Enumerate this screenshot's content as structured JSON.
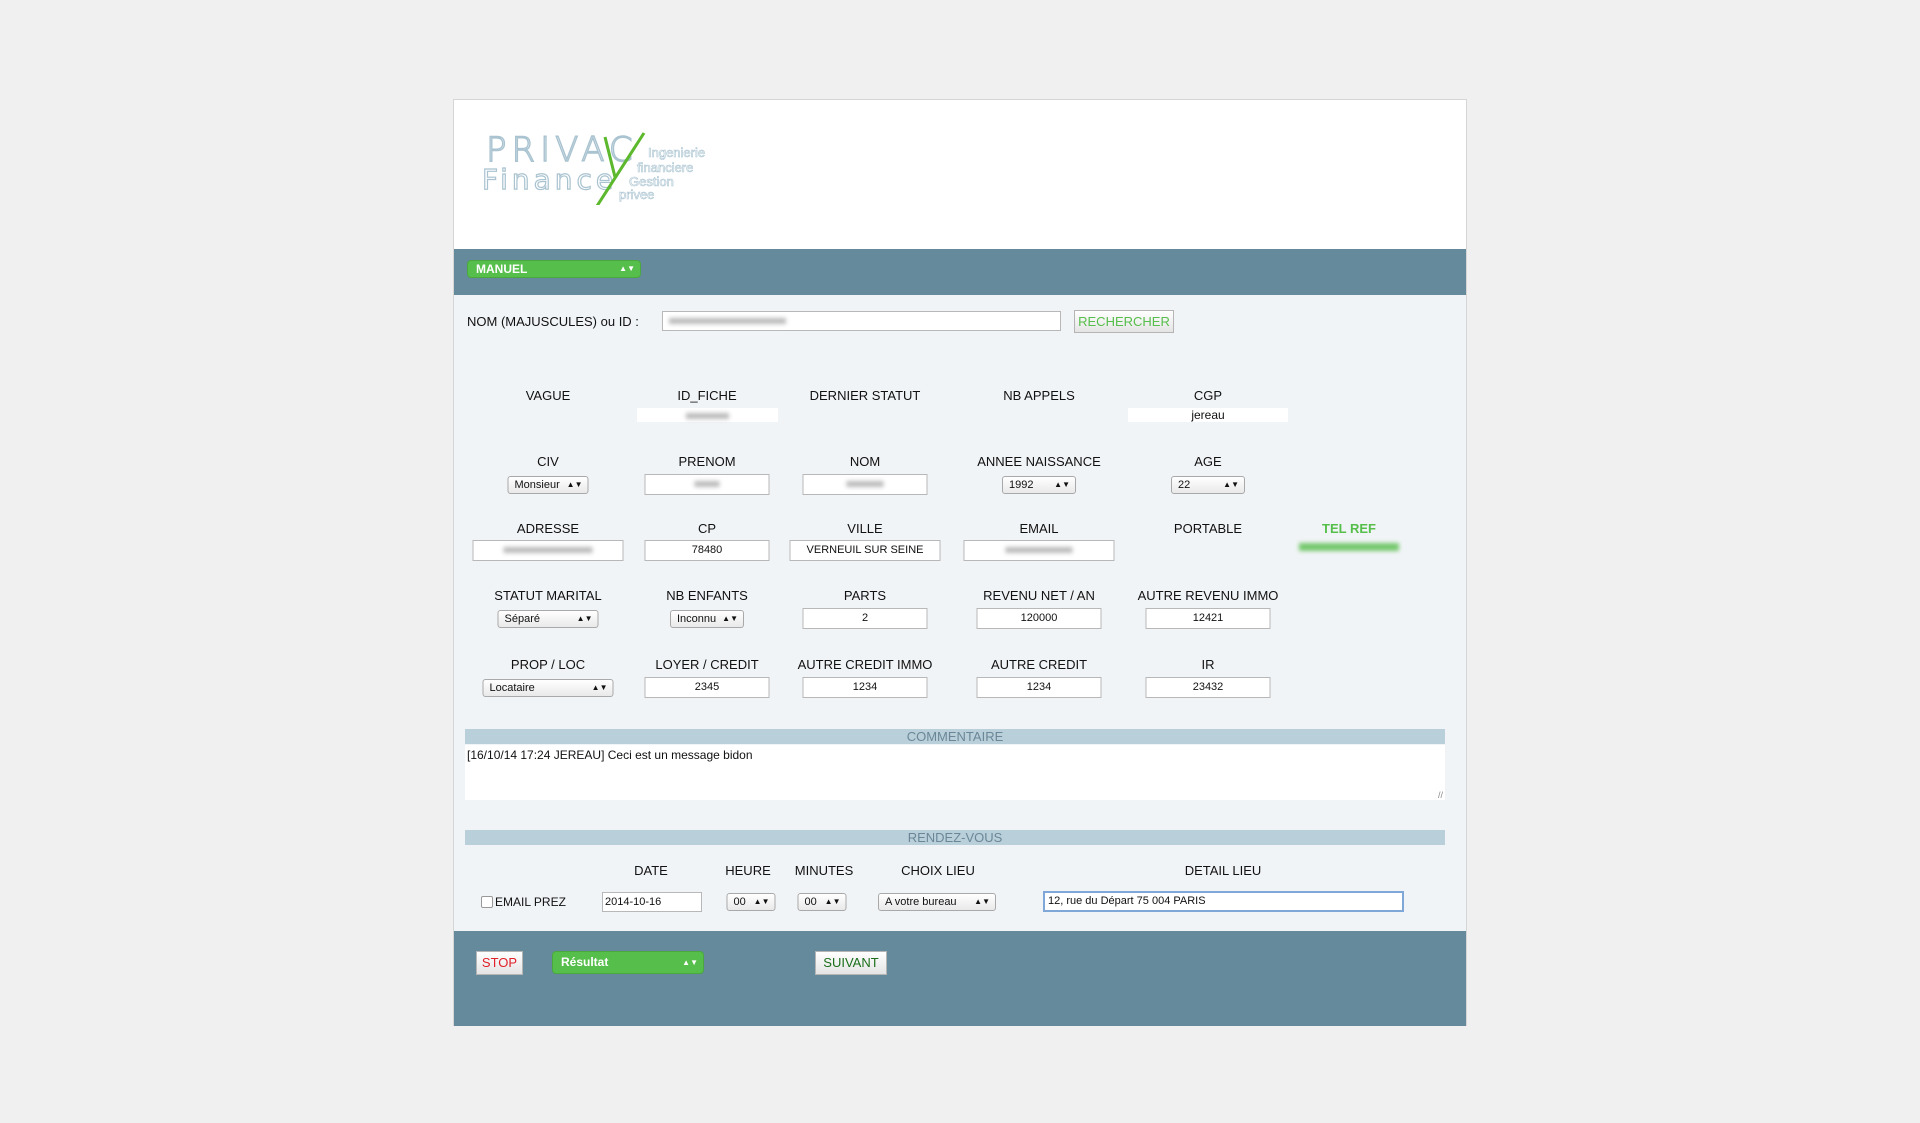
{
  "logo": {
    "brand_line1": "PRIVACY",
    "brand_line2": "Finance",
    "tagline": [
      "Ingenierie",
      "financiere",
      "Gestion",
      "privee"
    ]
  },
  "mode_select": {
    "value": "MANUEL"
  },
  "search": {
    "label": "NOM (MAJUSCULES) ou ID :",
    "button": "RECHERCHER"
  },
  "row1": {
    "vague": "VAGUE",
    "id_fiche": "ID_FICHE",
    "dernier_statut": "DERNIER STATUT",
    "nb_appels": "NB APPELS",
    "cgp": "CGP",
    "cgp_value": "jereau"
  },
  "row2": {
    "civ": "CIV",
    "civ_value": "Monsieur",
    "prenom": "PRENOM",
    "nom": "NOM",
    "annee": "ANNEE NAISSANCE",
    "annee_value": "1992",
    "age": "AGE",
    "age_value": "22"
  },
  "row3": {
    "adresse": "ADRESSE",
    "cp": "CP",
    "cp_value": "78480",
    "ville": "VILLE",
    "ville_value": "VERNEUIL SUR SEINE",
    "email": "EMAIL",
    "portable": "PORTABLE",
    "tel_ref": "TEL REF"
  },
  "row4": {
    "statut": "STATUT MARITAL",
    "statut_value": "Séparé",
    "nb_enfants": "NB ENFANTS",
    "nb_enfants_value": "Inconnu",
    "parts": "PARTS",
    "parts_value": "2",
    "revenu": "REVENU NET / AN",
    "revenu_value": "120000",
    "autre_revenu": "AUTRE REVENU IMMO",
    "autre_revenu_value": "12421"
  },
  "row5": {
    "prop": "PROP / LOC",
    "prop_value": "Locataire",
    "loyer": "LOYER / CREDIT",
    "loyer_value": "2345",
    "autre_credit_immo": "AUTRE CREDIT IMMO",
    "autre_credit_immo_value": "1234",
    "autre_credit": "AUTRE CREDIT",
    "autre_credit_value": "1234",
    "ir": "IR",
    "ir_value": "23432"
  },
  "commentaire": {
    "title": "COMMENTAIRE",
    "text": "[16/10/14 17:24 JEREAU] Ceci est un message bidon"
  },
  "rdv": {
    "title": "RENDEZ-VOUS",
    "email_prez": "EMAIL PREZ",
    "date_label": "DATE",
    "date_value": "2014-10-16",
    "heure_label": "HEURE",
    "heure_value": "00",
    "minutes_label": "MINUTES",
    "minutes_value": "00",
    "choix_label": "CHOIX LIEU",
    "choix_value": "A votre bureau",
    "detail_label": "DETAIL LIEU",
    "detail_value": "12, rue du Départ 75 004 PARIS"
  },
  "footer": {
    "stop": "STOP",
    "resultat": "Résultat",
    "suivant": "SUIVANT"
  },
  "colors": {
    "green": "#56be4a",
    "bar": "#658a9c",
    "section": "#b9cfda",
    "stop": "#e0202a"
  }
}
